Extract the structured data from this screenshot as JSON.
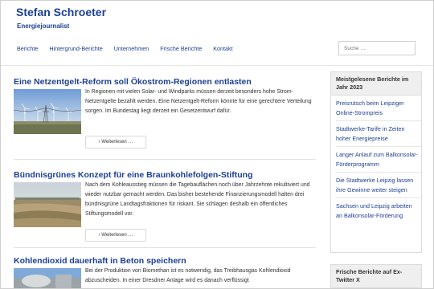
{
  "site": {
    "title": "Stefan Schroeter",
    "description": "Energiejournalist"
  },
  "nav": [
    "Berichte",
    "Hintergrund-Berichte",
    "Unternehmen",
    "Frische Berichte",
    "Kontakt"
  ],
  "search": {
    "placeholder": "Suche …"
  },
  "posts": [
    {
      "title": "Eine Netzentgelt-Reform soll Ökostrom-Regionen entlasten",
      "excerpt": "In Regionen mit vielen Solar- und Windparks müssen derzeit besonders hohe Strom-Netzentgelte bezahlt werden. Eine Netzentgelt-Reform könnte für eine gerechtere Verteilung sorgen. Im Bundestag liegt derzeit ein Gesetzentwurf dafür.",
      "more": "Weiterlesen …"
    },
    {
      "title": "Bündnisgrünes Konzept für eine Braunkohlefolgen-Stiftung",
      "excerpt": "Nach dem Kohleausstieg müssen die Tagebauflächen noch über Jahrzehnte rekultiviert und wieder nutzbar gemacht werden. Das bisher bestehende Finanzierungsmodell halten drei bündnisgrüne Landtagsfraktionen für riskant. Sie schlagen deshalb ein öffentliches Stiftungsmodell vor.",
      "more": "Weiterlesen …"
    },
    {
      "title": "Kohlendioxid dauerhaft in Beton speichern",
      "excerpt": "Bei der Produktion von Biomethan ist es notwendig, das Treibhausgas Kohlendioxid abzuscheiden. In einer Dresdner Anlage wird es danach verflüssigt"
    }
  ],
  "sidebar": {
    "popular": {
      "heading": "Meistgelesene Berichte im Jahr 2023",
      "items": [
        "Preisrutsch beim Leipziger Online-Strompreis",
        "Stadtwerke-Tarife in Zeiten hoher Energiepreise",
        "Langer Anlauf zum Balkonsolar-Förderprogramm",
        "Die Stadtwerke Leipzig lassen ihre Gewinne weiter steigen",
        "Sachsen und Leipzig arbeiten an Balkonsolar-Förderung"
      ]
    },
    "fresh": {
      "heading": "Frische Berichte auf Ex-Twitter X"
    }
  },
  "colors": {
    "link": "#1c3f94",
    "text": "#333333",
    "border": "#dcdcdc"
  },
  "icons": {
    "more": "chevron-right-icon"
  }
}
